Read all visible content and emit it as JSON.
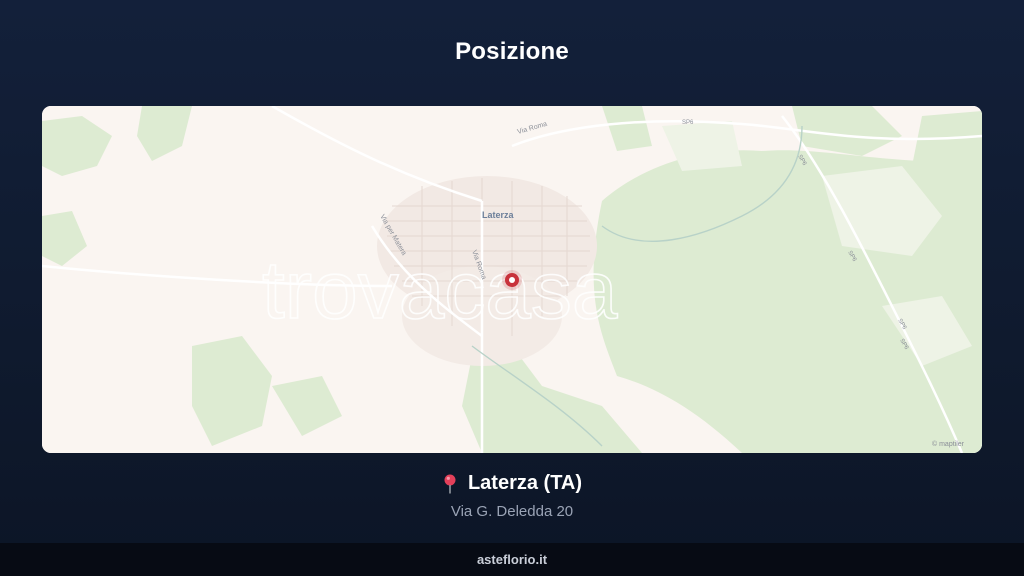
{
  "page": {
    "title": "Posizione"
  },
  "map": {
    "town_label": "Laterza",
    "road_labels": [
      "Via Roma",
      "Via per Matera",
      "Via Roma",
      "SP6",
      "SP6",
      "SP6",
      "SP6",
      "SP6"
    ],
    "watermark_text": "trovacasa",
    "attribution": "© maptiler",
    "colors": {
      "land": "#faf5f1",
      "vegetation": "#ddebd2",
      "marker": "#c8323b"
    }
  },
  "location": {
    "pin_icon": "round-pushpin-icon",
    "city": "Laterza (TA)",
    "address": "Via G. Deledda 20"
  },
  "footer": {
    "brand": "asteflorio.it"
  }
}
